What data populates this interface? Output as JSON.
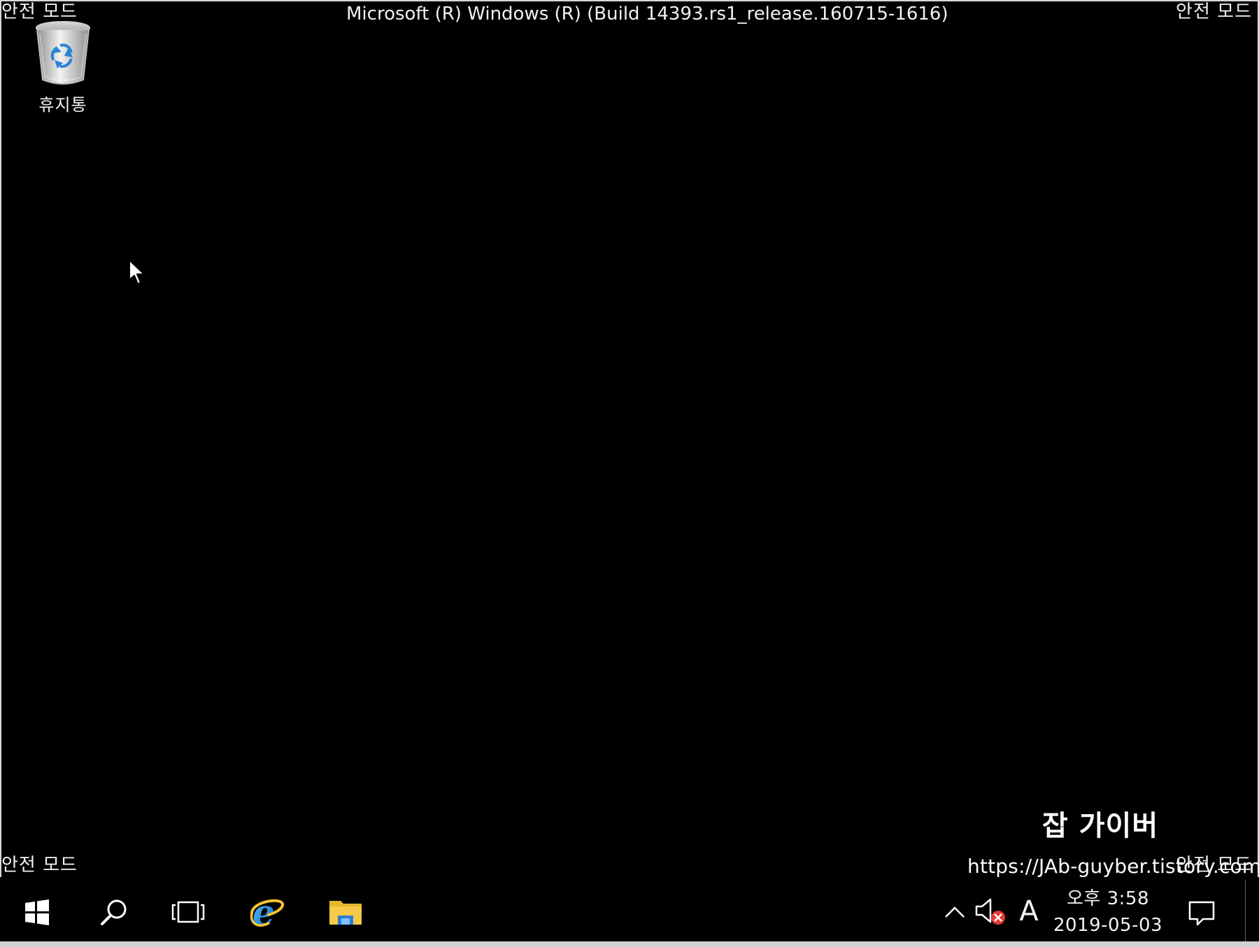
{
  "window": {
    "title": "Microsoft (R) Windows (R) (Build 14393.rs1_release.160715-1616)",
    "mode_label": "안전 모드"
  },
  "desktop": {
    "icons": [
      {
        "label": "휴지통",
        "icon": "recycle-bin-icon"
      }
    ]
  },
  "watermark": {
    "title": "잡 가이버",
    "url": "https://JAb-guyber.tistory.com"
  },
  "taskbar": {
    "pinned": [
      {
        "name": "start",
        "icon": "windows-logo-icon"
      },
      {
        "name": "search",
        "icon": "search-icon"
      },
      {
        "name": "task-view",
        "icon": "task-view-icon"
      },
      {
        "name": "internet-explorer",
        "icon": "internet-explorer-icon"
      },
      {
        "name": "file-explorer",
        "icon": "folder-icon"
      }
    ],
    "tray": {
      "chevron_icon": "chevron-up-icon",
      "volume_icon": "volume-muted-icon",
      "ime": "A",
      "time": "오후 3:58",
      "date": "2019-05-03",
      "notification_icon": "notification-icon"
    }
  },
  "colors": {
    "background": "#000000",
    "text": "#f0f0f0",
    "ie_blue": "#1e90ff",
    "folder_yellow": "#f7c948",
    "mute_red": "#e53935"
  }
}
